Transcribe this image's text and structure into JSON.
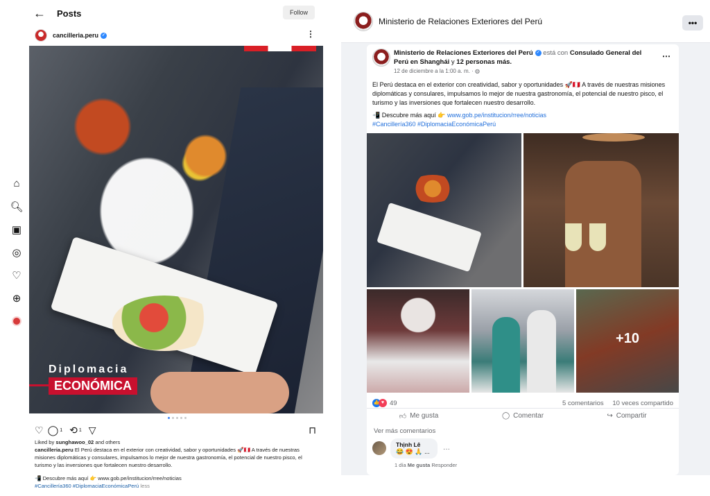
{
  "instagram": {
    "header": {
      "title": "Posts",
      "follow_label": "Follow"
    },
    "account": {
      "handle": "cancilleria.peru"
    },
    "photo": {
      "overlay_line1": "Diplomacia",
      "overlay_line2": "ECONÓMICA"
    },
    "actions": {
      "comments_count": "1",
      "reposts_count": "1"
    },
    "liked_by": {
      "prefix": "Liked by",
      "user": "sunghawoo_02",
      "suffix": "and others"
    },
    "caption": {
      "author": "cancilleria.peru",
      "text": "El Perú destaca en el exterior con creatividad, sabor y oportunidades 🚀🇵🇪 A través de nuestras misiones diplomáticas y consulares, impulsamos lo mejor de nuestra gastronomía, el potencial de nuestro pisco, el turismo y las inversiones que fortalecen nuestro desarrollo.",
      "link_line": "📲 Descubre más aquí 👉 www.gob.pe/institucion/rree/noticias",
      "hashtags": "#Cancillería360 #DiplomaciaEconómicaPerú",
      "less": "less"
    },
    "rail_icons": [
      "home-icon",
      "search-icon",
      "reels-icon",
      "messenger-icon",
      "heart-icon",
      "create-icon",
      "profile-avatar"
    ]
  },
  "facebook": {
    "topbar": {
      "page_name": "Ministerio de Relaciones Exteriores del Perú",
      "more": "•••"
    },
    "post": {
      "author": "Ministerio de Relaciones Exteriores del Perú",
      "with_text": "está con",
      "with_entity": "Consulado General del Perú en Shanghái",
      "and_text": "y",
      "others": "12 personas más.",
      "date": "12 de diciembre a la 1:00 a. m. ·",
      "body": "El Perú destaca en el exterior con creatividad, sabor y oportunidades 🚀🇵🇪 A través de nuestras misiones diplomáticas y consulares, impulsamos lo mejor de nuestra gastronomía, el potencial de nuestro pisco, el turismo y las inversiones que fortalecen nuestro desarrollo.",
      "link_prefix": "📲 Descubre más aquí 👉",
      "link": "www.gob.pe/institucion/rree/noticias",
      "hashtags": "#Cancillería360 #DiplomaciaEconómicaPerú",
      "more_photos": "+10"
    },
    "stats": {
      "reactions": "49",
      "comments": "5 comentarios",
      "shares": "10 veces compartido"
    },
    "actions": {
      "like": "Me gusta",
      "comment": "Comentar",
      "share": "Compartir"
    },
    "more_comments": "Ver más comentarios",
    "comment": {
      "author": "Thịnh Lê",
      "text": "😂 😍 🙏 ...",
      "time": "1 día",
      "like": "Me gusta",
      "reply": "Responder"
    },
    "colors": {
      "link": "#216fdb",
      "like": "#1877f2",
      "love": "#f33e58",
      "peru_red": "#c8102e"
    }
  }
}
